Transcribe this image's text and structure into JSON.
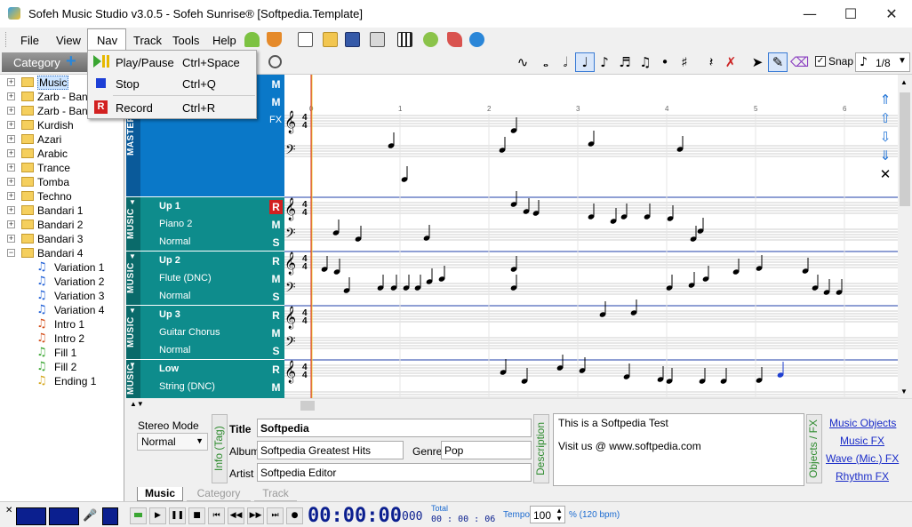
{
  "window": {
    "title": "Sofeh Music Studio v3.0.5 - Sofeh Sunrise®  [Softpedia.Template]",
    "minimize": "—",
    "maximize": "☐",
    "close": "✕"
  },
  "menu": {
    "file": "File",
    "view": "View",
    "nav": "Nav",
    "track": "Track",
    "tools": "Tools",
    "help": "Help"
  },
  "nav_menu": {
    "items": [
      {
        "label": "Play/Pause",
        "shortcut": "Ctrl+Space",
        "icon": "play-pause-icon"
      },
      {
        "label": "Stop",
        "shortcut": "Ctrl+Q",
        "icon": "stop-icon"
      },
      {
        "label": "Record",
        "shortcut": "Ctrl+R",
        "icon": "record-icon",
        "icon_text": "R"
      }
    ]
  },
  "category": {
    "label": "Category"
  },
  "note_toolbar": {
    "snap_label": "Snap",
    "snap_checked": "✓",
    "division": "1/8",
    "icons": [
      "curve-icon",
      "whole-note-icon",
      "half-note-icon",
      "quarter-note-icon",
      "eighth-note-icon",
      "sixteenth-note-icon",
      "thirtysecond-note-icon",
      "dot-icon",
      "sharp-icon",
      "rest-icon",
      "delete-rest-icon",
      "pointer-icon",
      "pencil-icon",
      "eraser-icon"
    ]
  },
  "tree": [
    {
      "label": "Music",
      "level": 0,
      "kind": "folder",
      "selected": true
    },
    {
      "label": "Zarb - Band",
      "level": 0,
      "kind": "folder"
    },
    {
      "label": "Zarb - Band",
      "level": 0,
      "kind": "folder"
    },
    {
      "label": "Kurdish",
      "level": 0,
      "kind": "folder"
    },
    {
      "label": "Azari",
      "level": 0,
      "kind": "folder"
    },
    {
      "label": "Arabic",
      "level": 0,
      "kind": "folder"
    },
    {
      "label": "Trance",
      "level": 0,
      "kind": "folder"
    },
    {
      "label": "Tomba",
      "level": 0,
      "kind": "folder"
    },
    {
      "label": "Techno",
      "level": 0,
      "kind": "folder"
    },
    {
      "label": "Bandari 1",
      "level": 0,
      "kind": "folder"
    },
    {
      "label": "Bandari 2",
      "level": 0,
      "kind": "folder"
    },
    {
      "label": "Bandari 3",
      "level": 0,
      "kind": "folder"
    },
    {
      "label": "Bandari 4",
      "level": 0,
      "kind": "folder",
      "expanded": true
    },
    {
      "label": "Variation 1",
      "level": 1,
      "kind": "note",
      "color": "#1f5fd6"
    },
    {
      "label": "Variation 2",
      "level": 1,
      "kind": "note",
      "color": "#1f5fd6"
    },
    {
      "label": "Variation 3",
      "level": 1,
      "kind": "note",
      "color": "#1f5fd6"
    },
    {
      "label": "Variation 4",
      "level": 1,
      "kind": "note",
      "color": "#1f5fd6"
    },
    {
      "label": "Intro 1",
      "level": 1,
      "kind": "note",
      "color": "#d4501c"
    },
    {
      "label": "Intro 2",
      "level": 1,
      "kind": "note",
      "color": "#d4501c"
    },
    {
      "label": "Fill 1",
      "level": 1,
      "kind": "note",
      "color": "#3aa632"
    },
    {
      "label": "Fill 2",
      "level": 1,
      "kind": "note",
      "color": "#3aa632"
    },
    {
      "label": "Ending 1",
      "level": 1,
      "kind": "note",
      "color": "#d6a81f"
    }
  ],
  "tracks": [
    {
      "section": "MASTER",
      "name": "",
      "instrument": "",
      "mode": "",
      "flags": [
        "M",
        "M",
        "FX"
      ],
      "color": "#0a78c8"
    },
    {
      "section": "MUSIC",
      "name": "Up 1",
      "instrument": "Piano 2",
      "mode": "Normal",
      "flags": [
        "R",
        "M",
        "S"
      ],
      "color": "#0e8c8c"
    },
    {
      "section": "MUSIC",
      "name": "Up 2",
      "instrument": "Flute (DNC)",
      "mode": "Normal",
      "flags": [
        "R",
        "M",
        "S"
      ],
      "color": "#0e8c8c"
    },
    {
      "section": "MUSIC",
      "name": "Up 3",
      "instrument": "Guitar Chorus",
      "mode": "Normal",
      "flags": [
        "R",
        "M",
        "S"
      ],
      "color": "#0e8c8c"
    },
    {
      "section": "MUSIC",
      "name": "Low",
      "instrument": "String (DNC)",
      "mode": "",
      "flags": [
        "R",
        "M"
      ],
      "color": "#0e8c8c"
    }
  ],
  "score": {
    "measures": [
      "0",
      "1",
      "2",
      "3",
      "4",
      "5",
      "6"
    ],
    "time_signature": "4/4",
    "playhead_color": "#d22020"
  },
  "info": {
    "stereo_mode_label": "Stereo Mode",
    "stereo_mode_value": "Normal",
    "info_tag_label": "Info (Tag)",
    "title_label": "Title",
    "title_value": "Softpedia",
    "album_label": "Album",
    "album_value": "Softpedia Greatest Hits",
    "genre_label": "Genre",
    "genre_value": "Pop",
    "artist_label": "Artist",
    "artist_value": "Softpedia Editor",
    "description_label": "Description",
    "description_line1": "This is a Softpedia Test",
    "description_line2": "Visit us @ www.softpedia.com",
    "objects_label": "Objects / FX",
    "links": [
      "Music Objects",
      "Music FX",
      "Wave (Mic.) FX",
      "Rhythm FX"
    ]
  },
  "tabs": [
    "Music",
    "Category",
    "Track"
  ],
  "transport": {
    "time": "00:00:00",
    "frames": "000",
    "total_label": "Total",
    "total_time": "00 : 00 : 06",
    "tempo_label": "Tempo",
    "tempo_value": "100",
    "bpm": "% (120 bpm)"
  }
}
